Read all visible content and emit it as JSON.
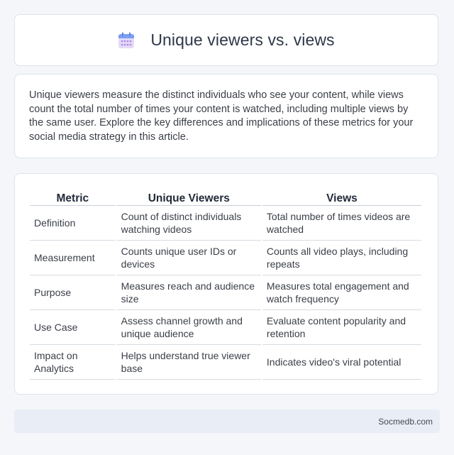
{
  "header": {
    "title": "Unique viewers vs. views",
    "icon": "calendar-icon",
    "icon_colors": {
      "top": "#7b9ef0",
      "body": "#e4dcf7",
      "dots": "#b48be8"
    }
  },
  "intro": {
    "text": "Unique viewers measure the distinct individuals who see your content, while views count the total number of times your content is watched, including multiple views by the same user. Explore the key differences and implications of these metrics for your social media strategy in this article."
  },
  "table": {
    "headers": [
      "Metric",
      "Unique Viewers",
      "Views"
    ],
    "rows": [
      [
        "Definition",
        "Count of distinct individuals watching videos",
        "Total number of times videos are watched"
      ],
      [
        "Measurement",
        "Counts unique user IDs or devices",
        "Counts all video plays, including repeats"
      ],
      [
        "Purpose",
        "Measures reach and audience size",
        "Measures total engagement and watch frequency"
      ],
      [
        "Use Case",
        "Assess channel growth and unique audience",
        "Evaluate content popularity and retention"
      ],
      [
        "Impact on Analytics",
        "Helps understand true viewer base",
        "Indicates video's viral potential"
      ]
    ]
  },
  "footer": {
    "site": "Socmedb.com"
  }
}
